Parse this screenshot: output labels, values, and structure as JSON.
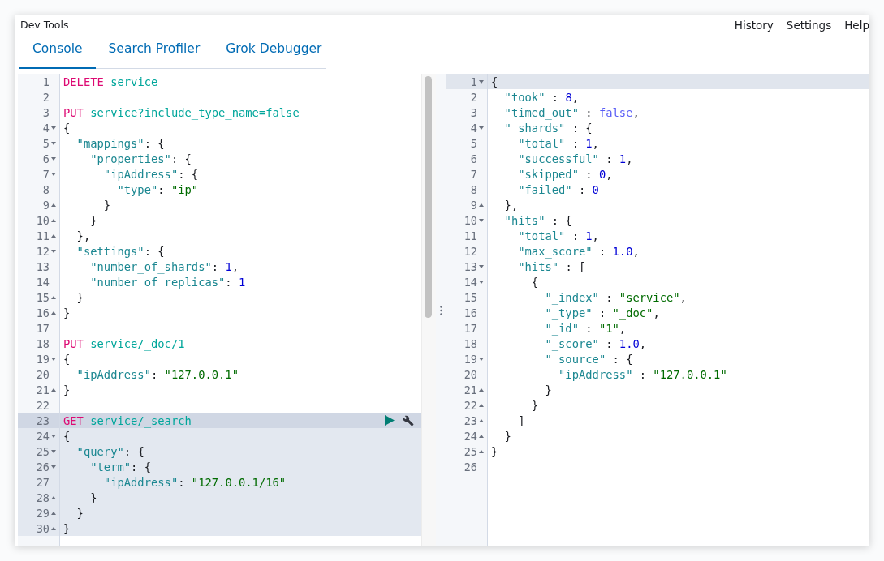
{
  "header": {
    "title": "Dev Tools",
    "links": [
      "History",
      "Settings",
      "Help"
    ]
  },
  "tabs": [
    {
      "label": "Console",
      "selected": true
    },
    {
      "label": "Search Profiler",
      "selected": false
    },
    {
      "label": "Grok Debugger",
      "selected": false
    }
  ],
  "request_editor": {
    "lines": [
      {
        "number": "1",
        "fold_start": false,
        "fold_end": false,
        "active": false,
        "selected": false,
        "tokens": [
          {
            "kind": "method",
            "text": "DELETE"
          },
          {
            "kind": "url",
            "text": " service"
          }
        ]
      },
      {
        "number": "2",
        "fold_start": false,
        "fold_end": false,
        "active": false,
        "selected": false
      },
      {
        "number": "3",
        "fold_start": false,
        "fold_end": false,
        "active": false,
        "selected": false,
        "tokens": [
          {
            "kind": "method",
            "text": "PUT"
          },
          {
            "kind": "url",
            "text": " service?include_type_name=false"
          }
        ]
      },
      {
        "number": "4",
        "fold_start": true,
        "fold_end": false,
        "active": false,
        "selected": false,
        "tokens": [
          {
            "kind": "punct",
            "text": "{"
          }
        ]
      },
      {
        "number": "5",
        "fold_start": true,
        "fold_end": false,
        "active": false,
        "selected": false,
        "tokens": [
          {
            "kind": "key",
            "text": "  \"mappings\""
          },
          {
            "kind": "punct",
            "text": ": {"
          }
        ]
      },
      {
        "number": "6",
        "fold_start": true,
        "fold_end": false,
        "active": false,
        "selected": false,
        "tokens": [
          {
            "kind": "key",
            "text": "    \"properties\""
          },
          {
            "kind": "punct",
            "text": ": {"
          }
        ]
      },
      {
        "number": "7",
        "fold_start": true,
        "fold_end": false,
        "active": false,
        "selected": false,
        "tokens": [
          {
            "kind": "key",
            "text": "      \"ipAddress\""
          },
          {
            "kind": "punct",
            "text": ": {"
          }
        ]
      },
      {
        "number": "8",
        "fold_start": false,
        "fold_end": false,
        "active": false,
        "selected": false,
        "tokens": [
          {
            "kind": "key",
            "text": "        \"type\""
          },
          {
            "kind": "punct",
            "text": ": "
          },
          {
            "kind": "string",
            "text": "\"ip\""
          }
        ]
      },
      {
        "number": "9",
        "fold_start": false,
        "fold_end": true,
        "active": false,
        "selected": false,
        "tokens": [
          {
            "kind": "punct",
            "text": "      }"
          }
        ]
      },
      {
        "number": "10",
        "fold_start": false,
        "fold_end": true,
        "active": false,
        "selected": false,
        "tokens": [
          {
            "kind": "punct",
            "text": "    }"
          }
        ]
      },
      {
        "number": "11",
        "fold_start": false,
        "fold_end": true,
        "active": false,
        "selected": false,
        "tokens": [
          {
            "kind": "punct",
            "text": "  },"
          }
        ]
      },
      {
        "number": "12",
        "fold_start": true,
        "fold_end": false,
        "active": false,
        "selected": false,
        "tokens": [
          {
            "kind": "key",
            "text": "  \"settings\""
          },
          {
            "kind": "punct",
            "text": ": {"
          }
        ]
      },
      {
        "number": "13",
        "fold_start": false,
        "fold_end": false,
        "active": false,
        "selected": false,
        "tokens": [
          {
            "kind": "key",
            "text": "    \"number_of_shards\""
          },
          {
            "kind": "punct",
            "text": ": "
          },
          {
            "kind": "number",
            "text": "1"
          },
          {
            "kind": "punct",
            "text": ","
          }
        ]
      },
      {
        "number": "14",
        "fold_start": false,
        "fold_end": false,
        "active": false,
        "selected": false,
        "tokens": [
          {
            "kind": "key",
            "text": "    \"number_of_replicas\""
          },
          {
            "kind": "punct",
            "text": ": "
          },
          {
            "kind": "number",
            "text": "1"
          }
        ]
      },
      {
        "number": "15",
        "fold_start": false,
        "fold_end": true,
        "active": false,
        "selected": false,
        "tokens": [
          {
            "kind": "punct",
            "text": "  }"
          }
        ]
      },
      {
        "number": "16",
        "fold_start": false,
        "fold_end": true,
        "active": false,
        "selected": false,
        "tokens": [
          {
            "kind": "punct",
            "text": "}"
          }
        ]
      },
      {
        "number": "17",
        "fold_start": false,
        "fold_end": false,
        "active": false,
        "selected": false
      },
      {
        "number": "18",
        "fold_start": false,
        "fold_end": false,
        "active": false,
        "selected": false,
        "tokens": [
          {
            "kind": "method",
            "text": "PUT"
          },
          {
            "kind": "url",
            "text": " service/_doc/1"
          }
        ]
      },
      {
        "number": "19",
        "fold_start": true,
        "fold_end": false,
        "active": false,
        "selected": false,
        "tokens": [
          {
            "kind": "punct",
            "text": "{"
          }
        ]
      },
      {
        "number": "20",
        "fold_start": false,
        "fold_end": false,
        "active": false,
        "selected": false,
        "tokens": [
          {
            "kind": "key",
            "text": "  \"ipAddress\""
          },
          {
            "kind": "punct",
            "text": ": "
          },
          {
            "kind": "string",
            "text": "\"127.0.0.1\""
          }
        ]
      },
      {
        "number": "21",
        "fold_start": false,
        "fold_end": true,
        "active": false,
        "selected": false,
        "tokens": [
          {
            "kind": "punct",
            "text": "}"
          }
        ]
      },
      {
        "number": "22",
        "fold_start": false,
        "fold_end": false,
        "active": false,
        "selected": false
      },
      {
        "number": "23",
        "fold_start": false,
        "fold_end": false,
        "active": true,
        "selected": true,
        "tokens": [
          {
            "kind": "method",
            "text": "GET"
          },
          {
            "kind": "url",
            "text": " service/_search"
          }
        ]
      },
      {
        "number": "24",
        "fold_start": true,
        "fold_end": false,
        "active": false,
        "selected": true,
        "tokens": [
          {
            "kind": "punct",
            "text": "{"
          }
        ]
      },
      {
        "number": "25",
        "fold_start": true,
        "fold_end": false,
        "active": false,
        "selected": true,
        "tokens": [
          {
            "kind": "key",
            "text": "  \"query\""
          },
          {
            "kind": "punct",
            "text": ": {"
          }
        ]
      },
      {
        "number": "26",
        "fold_start": true,
        "fold_end": false,
        "active": false,
        "selected": true,
        "tokens": [
          {
            "kind": "key",
            "text": "    \"term\""
          },
          {
            "kind": "punct",
            "text": ": {"
          }
        ]
      },
      {
        "number": "27",
        "fold_start": false,
        "fold_end": false,
        "active": false,
        "selected": true,
        "tokens": [
          {
            "kind": "key",
            "text": "      \"ipAddress\""
          },
          {
            "kind": "punct",
            "text": ": "
          },
          {
            "kind": "string",
            "text": "\"127.0.0.1/16\""
          }
        ]
      },
      {
        "number": "28",
        "fold_start": false,
        "fold_end": true,
        "active": false,
        "selected": true,
        "tokens": [
          {
            "kind": "punct",
            "text": "    }"
          }
        ]
      },
      {
        "number": "29",
        "fold_start": false,
        "fold_end": true,
        "active": false,
        "selected": true,
        "tokens": [
          {
            "kind": "punct",
            "text": "  }"
          }
        ]
      },
      {
        "number": "30",
        "fold_start": false,
        "fold_end": true,
        "active": false,
        "selected": true,
        "tokens": [
          {
            "kind": "punct",
            "text": "}"
          }
        ]
      }
    ]
  },
  "response_editor": {
    "lines": [
      {
        "number": "1",
        "fold_start": true,
        "fold_end": false,
        "active": true,
        "selected": false,
        "tokens": [
          {
            "kind": "punct",
            "text": "{"
          }
        ]
      },
      {
        "number": "2",
        "fold_start": false,
        "fold_end": false,
        "active": false,
        "selected": false,
        "tokens": [
          {
            "kind": "key",
            "text": "  \"took\""
          },
          {
            "kind": "punct",
            "text": " : "
          },
          {
            "kind": "number",
            "text": "8"
          },
          {
            "kind": "punct",
            "text": ","
          }
        ]
      },
      {
        "number": "3",
        "fold_start": false,
        "fold_end": false,
        "active": false,
        "selected": false,
        "tokens": [
          {
            "kind": "key",
            "text": "  \"timed_out\""
          },
          {
            "kind": "punct",
            "text": " : "
          },
          {
            "kind": "boolean",
            "text": "false"
          },
          {
            "kind": "punct",
            "text": ","
          }
        ]
      },
      {
        "number": "4",
        "fold_start": true,
        "fold_end": false,
        "active": false,
        "selected": false,
        "tokens": [
          {
            "kind": "key",
            "text": "  \"_shards\""
          },
          {
            "kind": "punct",
            "text": " : {"
          }
        ]
      },
      {
        "number": "5",
        "fold_start": false,
        "fold_end": false,
        "active": false,
        "selected": false,
        "tokens": [
          {
            "kind": "key",
            "text": "    \"total\""
          },
          {
            "kind": "punct",
            "text": " : "
          },
          {
            "kind": "number",
            "text": "1"
          },
          {
            "kind": "punct",
            "text": ","
          }
        ]
      },
      {
        "number": "6",
        "fold_start": false,
        "fold_end": false,
        "active": false,
        "selected": false,
        "tokens": [
          {
            "kind": "key",
            "text": "    \"successful\""
          },
          {
            "kind": "punct",
            "text": " : "
          },
          {
            "kind": "number",
            "text": "1"
          },
          {
            "kind": "punct",
            "text": ","
          }
        ]
      },
      {
        "number": "7",
        "fold_start": false,
        "fold_end": false,
        "active": false,
        "selected": false,
        "tokens": [
          {
            "kind": "key",
            "text": "    \"skipped\""
          },
          {
            "kind": "punct",
            "text": " : "
          },
          {
            "kind": "number",
            "text": "0"
          },
          {
            "kind": "punct",
            "text": ","
          }
        ]
      },
      {
        "number": "8",
        "fold_start": false,
        "fold_end": false,
        "active": false,
        "selected": false,
        "tokens": [
          {
            "kind": "key",
            "text": "    \"failed\""
          },
          {
            "kind": "punct",
            "text": " : "
          },
          {
            "kind": "number",
            "text": "0"
          }
        ]
      },
      {
        "number": "9",
        "fold_start": false,
        "fold_end": true,
        "active": false,
        "selected": false,
        "tokens": [
          {
            "kind": "punct",
            "text": "  },"
          }
        ]
      },
      {
        "number": "10",
        "fold_start": true,
        "fold_end": false,
        "active": false,
        "selected": false,
        "tokens": [
          {
            "kind": "key",
            "text": "  \"hits\""
          },
          {
            "kind": "punct",
            "text": " : {"
          }
        ]
      },
      {
        "number": "11",
        "fold_start": false,
        "fold_end": false,
        "active": false,
        "selected": false,
        "tokens": [
          {
            "kind": "key",
            "text": "    \"total\""
          },
          {
            "kind": "punct",
            "text": " : "
          },
          {
            "kind": "number",
            "text": "1"
          },
          {
            "kind": "punct",
            "text": ","
          }
        ]
      },
      {
        "number": "12",
        "fold_start": false,
        "fold_end": false,
        "active": false,
        "selected": false,
        "tokens": [
          {
            "kind": "key",
            "text": "    \"max_score\""
          },
          {
            "kind": "punct",
            "text": " : "
          },
          {
            "kind": "number",
            "text": "1.0"
          },
          {
            "kind": "punct",
            "text": ","
          }
        ]
      },
      {
        "number": "13",
        "fold_start": true,
        "fold_end": false,
        "active": false,
        "selected": false,
        "tokens": [
          {
            "kind": "key",
            "text": "    \"hits\""
          },
          {
            "kind": "punct",
            "text": " : ["
          }
        ]
      },
      {
        "number": "14",
        "fold_start": true,
        "fold_end": false,
        "active": false,
        "selected": false,
        "tokens": [
          {
            "kind": "punct",
            "text": "      {"
          }
        ]
      },
      {
        "number": "15",
        "fold_start": false,
        "fold_end": false,
        "active": false,
        "selected": false,
        "tokens": [
          {
            "kind": "key",
            "text": "        \"_index\""
          },
          {
            "kind": "punct",
            "text": " : "
          },
          {
            "kind": "string",
            "text": "\"service\""
          },
          {
            "kind": "punct",
            "text": ","
          }
        ]
      },
      {
        "number": "16",
        "fold_start": false,
        "fold_end": false,
        "active": false,
        "selected": false,
        "tokens": [
          {
            "kind": "key",
            "text": "        \"_type\""
          },
          {
            "kind": "punct",
            "text": " : "
          },
          {
            "kind": "string",
            "text": "\"_doc\""
          },
          {
            "kind": "punct",
            "text": ","
          }
        ]
      },
      {
        "number": "17",
        "fold_start": false,
        "fold_end": false,
        "active": false,
        "selected": false,
        "tokens": [
          {
            "kind": "key",
            "text": "        \"_id\""
          },
          {
            "kind": "punct",
            "text": " : "
          },
          {
            "kind": "string",
            "text": "\"1\""
          },
          {
            "kind": "punct",
            "text": ","
          }
        ]
      },
      {
        "number": "18",
        "fold_start": false,
        "fold_end": false,
        "active": false,
        "selected": false,
        "tokens": [
          {
            "kind": "key",
            "text": "        \"_score\""
          },
          {
            "kind": "punct",
            "text": " : "
          },
          {
            "kind": "number",
            "text": "1.0"
          },
          {
            "kind": "punct",
            "text": ","
          }
        ]
      },
      {
        "number": "19",
        "fold_start": true,
        "fold_end": false,
        "active": false,
        "selected": false,
        "tokens": [
          {
            "kind": "key",
            "text": "        \"_source\""
          },
          {
            "kind": "punct",
            "text": " : {"
          }
        ]
      },
      {
        "number": "20",
        "fold_start": false,
        "fold_end": false,
        "active": false,
        "selected": false,
        "tokens": [
          {
            "kind": "key",
            "text": "          \"ipAddress\""
          },
          {
            "kind": "punct",
            "text": " : "
          },
          {
            "kind": "string",
            "text": "\"127.0.0.1\""
          }
        ]
      },
      {
        "number": "21",
        "fold_start": false,
        "fold_end": true,
        "active": false,
        "selected": false,
        "tokens": [
          {
            "kind": "punct",
            "text": "        }"
          }
        ]
      },
      {
        "number": "22",
        "fold_start": false,
        "fold_end": true,
        "active": false,
        "selected": false,
        "tokens": [
          {
            "kind": "punct",
            "text": "      }"
          }
        ]
      },
      {
        "number": "23",
        "fold_start": false,
        "fold_end": true,
        "active": false,
        "selected": false,
        "tokens": [
          {
            "kind": "punct",
            "text": "    ]"
          }
        ]
      },
      {
        "number": "24",
        "fold_start": false,
        "fold_end": true,
        "active": false,
        "selected": false,
        "tokens": [
          {
            "kind": "punct",
            "text": "  }"
          }
        ]
      },
      {
        "number": "25",
        "fold_start": false,
        "fold_end": true,
        "active": false,
        "selected": false,
        "tokens": [
          {
            "kind": "punct",
            "text": "}"
          }
        ]
      },
      {
        "number": "26",
        "fold_start": false,
        "fold_end": false,
        "active": false,
        "selected": false
      }
    ]
  }
}
